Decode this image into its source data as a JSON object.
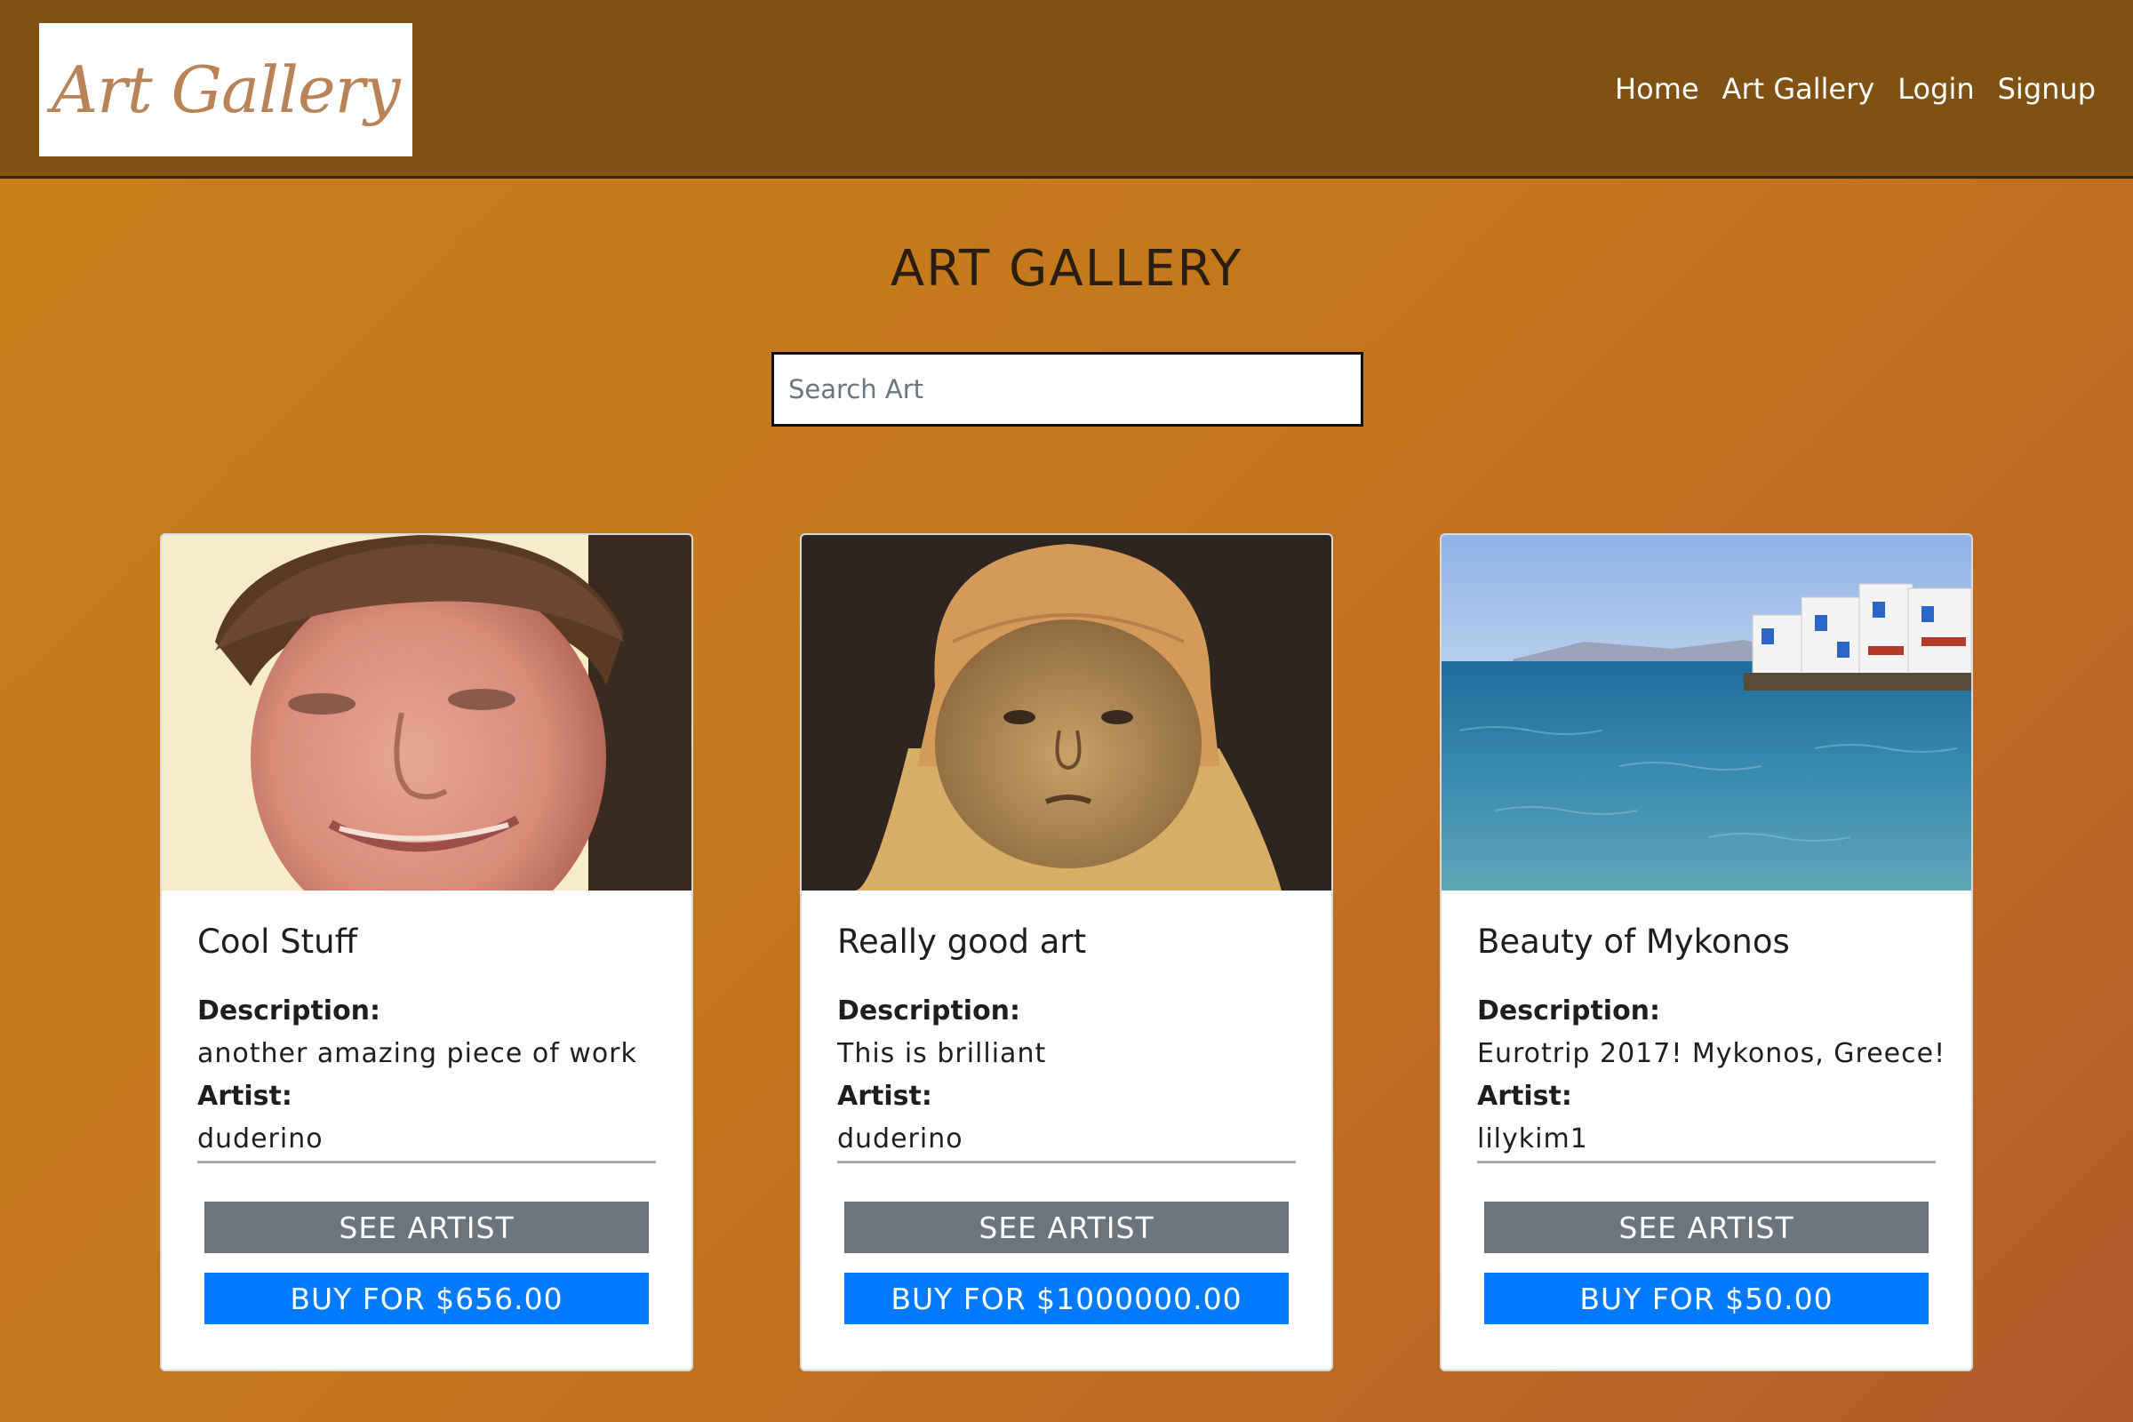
{
  "nav": {
    "logo_text": "Art Gallery",
    "links": [
      "Home",
      "Art Gallery",
      "Login",
      "Signup"
    ]
  },
  "page_title": "ART GALLERY",
  "search": {
    "placeholder": "Search Art",
    "value": ""
  },
  "cards": [
    {
      "image": "portrait-photo-smiling-young-man",
      "title": "Cool Stuff",
      "description_label": "Description:",
      "description": "another amazing piece of work",
      "artist_label": "Artist:",
      "artist": "duderino",
      "see_artist": "SEE ARTIST",
      "buy": "BUY FOR $656.00"
    },
    {
      "image": "painting-baby-in-bonnet",
      "title": "Really good art",
      "description_label": "Description:",
      "description": "This is brilliant",
      "artist_label": "Artist:",
      "artist": "duderino",
      "see_artist": "SEE ARTIST",
      "buy": "BUY FOR $1000000.00"
    },
    {
      "image": "seaside-village-photo",
      "title": "Beauty of Mykonos",
      "description_label": "Description:",
      "description": "Eurotrip 2017! Mykonos, Greece!",
      "artist_label": "Artist:",
      "artist": "lilykim1",
      "see_artist": "SEE ARTIST",
      "buy": "BUY FOR $50.00"
    }
  ],
  "colors": {
    "navbar": "#7f5214",
    "background": "#c4781c",
    "see_artist_button": "#6c757d",
    "buy_button": "#007bff"
  }
}
